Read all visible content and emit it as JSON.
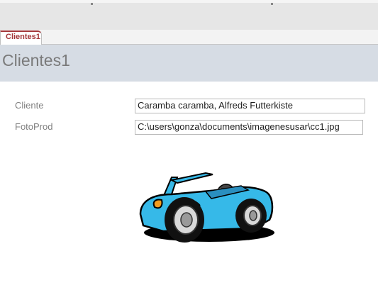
{
  "document_tab": {
    "label": "Clientes1"
  },
  "form": {
    "title": "Clientes1",
    "fields": [
      {
        "label": "Cliente",
        "value": "Caramba caramba, Alfreds Futterkiste"
      },
      {
        "label": "FotoProd",
        "value": "C:\\users\\gonza\\documents\\imagenesusar\\cc1.jpg"
      }
    ],
    "image": {
      "depicts": "blue-convertible-car"
    }
  },
  "colors": {
    "tab_accent": "#a4373a",
    "header_band": "#d6dce4",
    "car_body": "#36b9e8"
  }
}
